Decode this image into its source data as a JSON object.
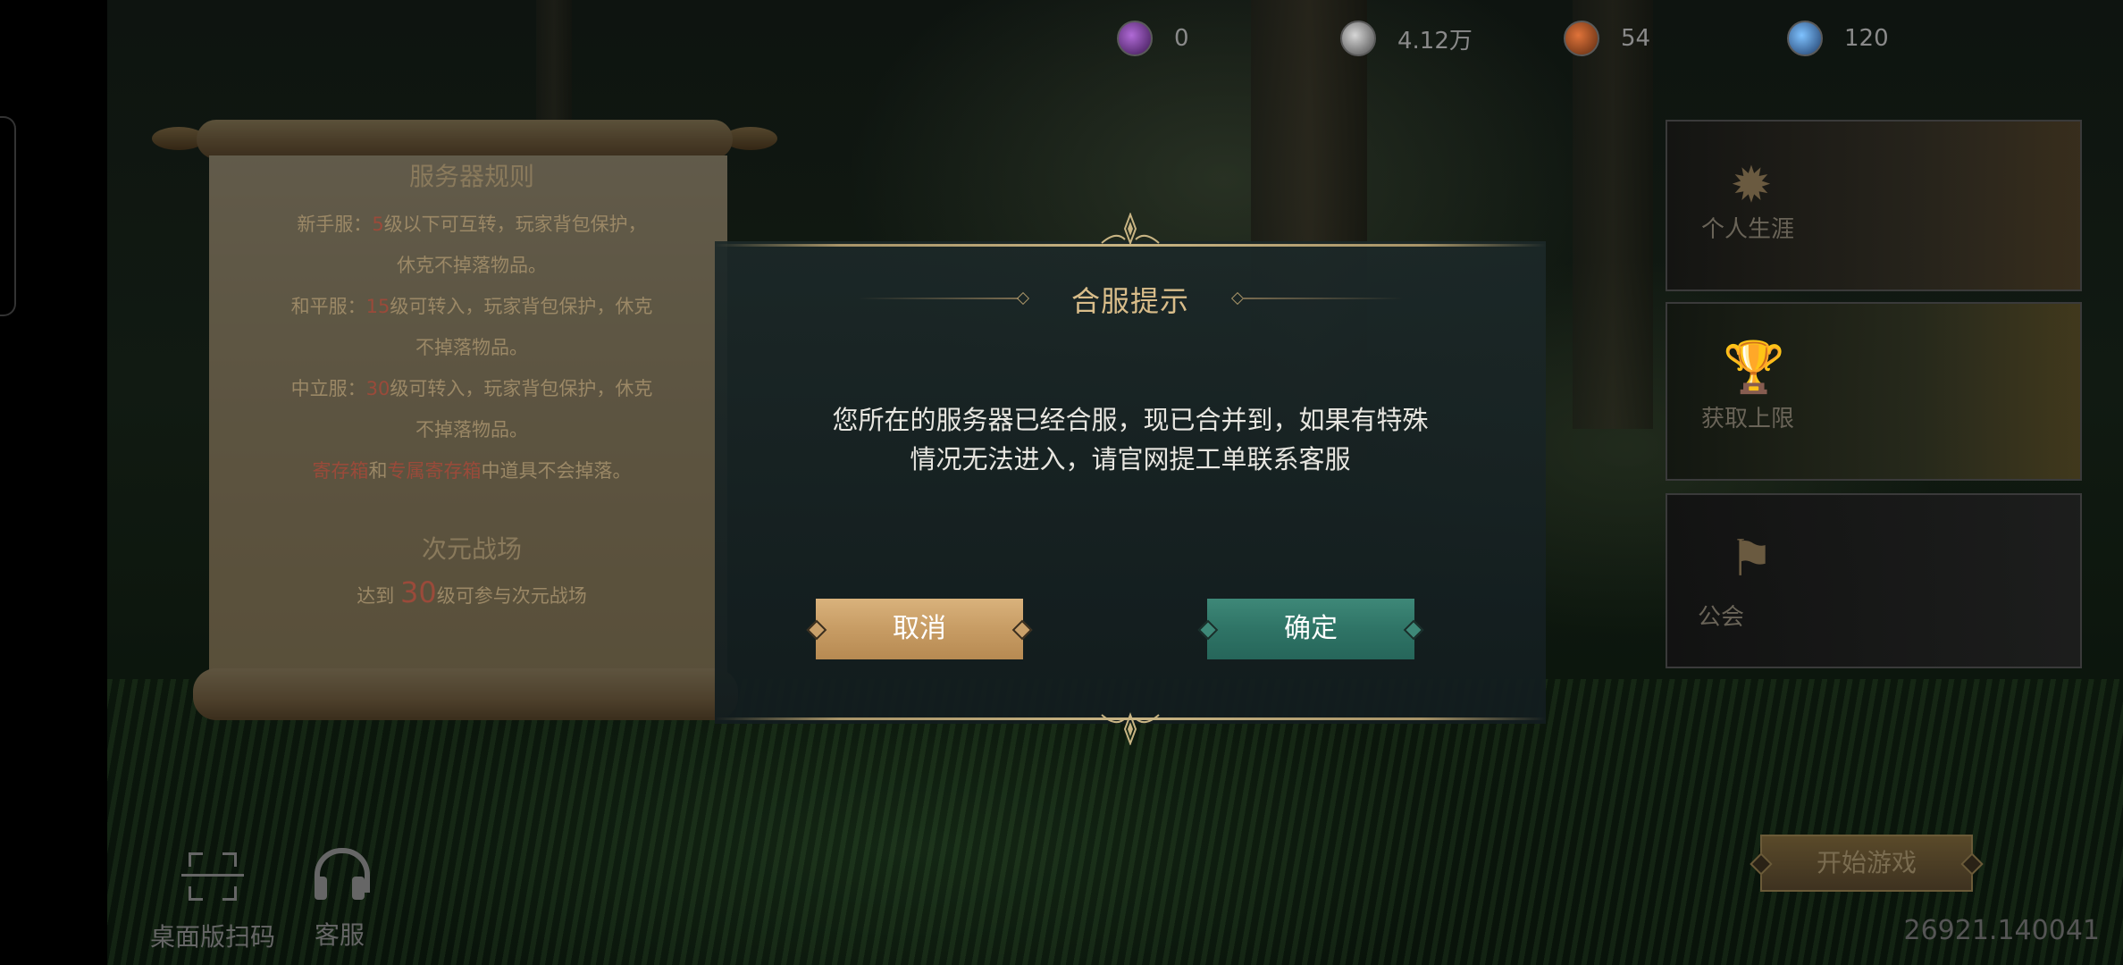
{
  "currencies": [
    {
      "icon": "purple-gem-icon",
      "value": "0"
    },
    {
      "icon": "silver-coin-icon",
      "value": "4.12万"
    },
    {
      "icon": "bronze-coin-icon",
      "value": "54"
    },
    {
      "icon": "blue-gem-icon",
      "value": "120"
    }
  ],
  "scroll": {
    "rules_title": "服务器规则",
    "line1_pre": "新手服：",
    "line1_num": "5",
    "line1_post": "级以下可互转，玩家背包保护，",
    "line1b": "休克不掉落物品。",
    "line2_pre": "和平服：",
    "line2_num": "15",
    "line2_post": "级可转入，玩家背包保护，休克",
    "line2b": "不掉落物品。",
    "line3_pre": "中立服：",
    "line3_num": "30",
    "line3_post": "级可转入，玩家背包保护，休克",
    "line3b": "不掉落物品。",
    "line4_hl1": "寄存箱",
    "line4_mid": "和",
    "line4_hl2": "专属寄存箱",
    "line4_post": "中道具不会掉落。",
    "section_title": "次元战场",
    "section_pre": "达到",
    "section_num": "30",
    "section_post": "级可参与次元战场"
  },
  "side_cards": [
    {
      "label": "个人生涯",
      "icon": "sun-emblem-icon"
    },
    {
      "label": "获取上限",
      "icon": "trophy-icon"
    },
    {
      "label": "公会",
      "icon": "guild-banner-icon"
    }
  ],
  "start_button": "开始游戏",
  "version": "26921.140041",
  "tools": {
    "scan_label": "桌面版扫码",
    "service_label": "客服"
  },
  "dialog": {
    "title": "合服提示",
    "message_line1": "您所在的服务器已经合服，现已合并到，如果有特殊",
    "message_line2": "情况无法进入，请官网提工单联系客服",
    "cancel_label": "取消",
    "confirm_label": "确定"
  },
  "colors": {
    "dialog_title": "#d9bd8a",
    "cancel_button": "#c79c64",
    "confirm_button": "#2f7466",
    "highlight_red": "#9a4a3a"
  }
}
